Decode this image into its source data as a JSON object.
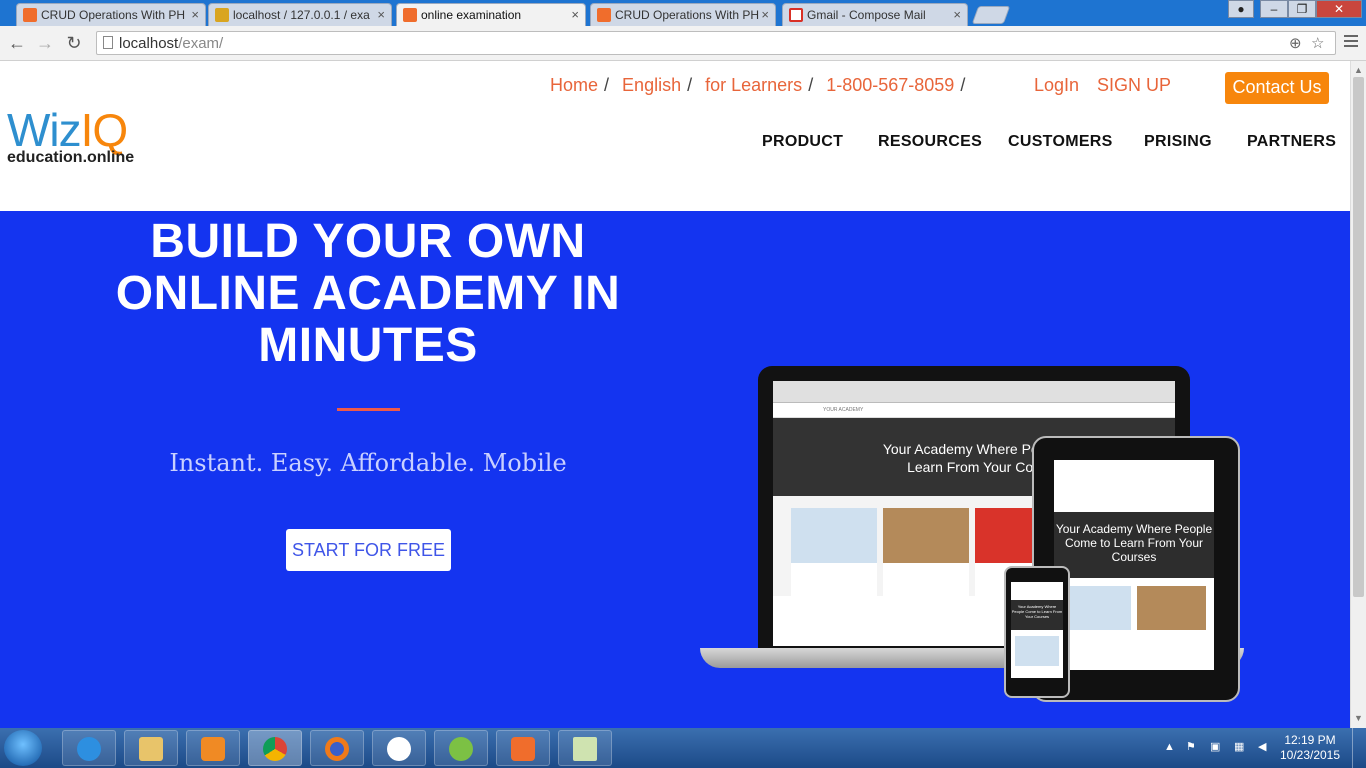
{
  "browser": {
    "tabs": [
      {
        "title": "CRUD Operations With PH",
        "favicon_color": "#f06d2c"
      },
      {
        "title": "localhost / 127.0.0.1 / exa",
        "favicon_color": "#d9a520"
      },
      {
        "title": "online examination",
        "favicon_color": "#f06d2c"
      },
      {
        "title": "CRUD Operations With PH",
        "favicon_color": "#f06d2c"
      },
      {
        "title": "Gmail - Compose Mail",
        "favicon_color": "#d93025"
      }
    ],
    "close_glyph": "×",
    "url_host": "localhost",
    "url_path": "/exam/",
    "window_controls": {
      "minimize": "–",
      "maximize": "❐",
      "close": "✕"
    }
  },
  "site": {
    "logo": {
      "brand_a": "Wiz",
      "brand_b": "IQ",
      "tagline": "education.online"
    },
    "top_links": [
      "Home",
      "English",
      "for Learners",
      "1-800-567-8059"
    ],
    "separator": "/",
    "login": "LogIn",
    "signup": "SIGN UP",
    "contact": "Contact Us",
    "main_nav": [
      "PRODUCT",
      "RESOURCES",
      "CUSTOMERS",
      "PRISING",
      "PARTNERS"
    ],
    "hero": {
      "title_lines": [
        "BUILD YOUR OWN",
        "ONLINE ACADEMY IN",
        "MINUTES"
      ],
      "subtitle": "Instant. Easy. Affordable. Mobile",
      "cta": "START FOR FREE"
    },
    "mockup": {
      "laptop_headline_1": "Your Academy Where People",
      "laptop_headline_2": "Learn From Your Cou",
      "tablet_headline": "Your Academy Where People Come to Learn From Your Courses",
      "phone_headline": "Your Academy Where People Come to Learn From Your Courses",
      "brand": "YOUR ACADEMY"
    },
    "colors": {
      "accent": "#e8653a",
      "hero_bg": "#1434f0",
      "contact_bg": "#f7860c"
    }
  },
  "taskbar": {
    "apps": [
      "internet-explorer",
      "file-explorer",
      "media-player",
      "chrome",
      "firefox",
      "yandex",
      "dreamweaver",
      "xampp",
      "notepad"
    ],
    "time": "12:19 PM",
    "date": "10/23/2015"
  }
}
